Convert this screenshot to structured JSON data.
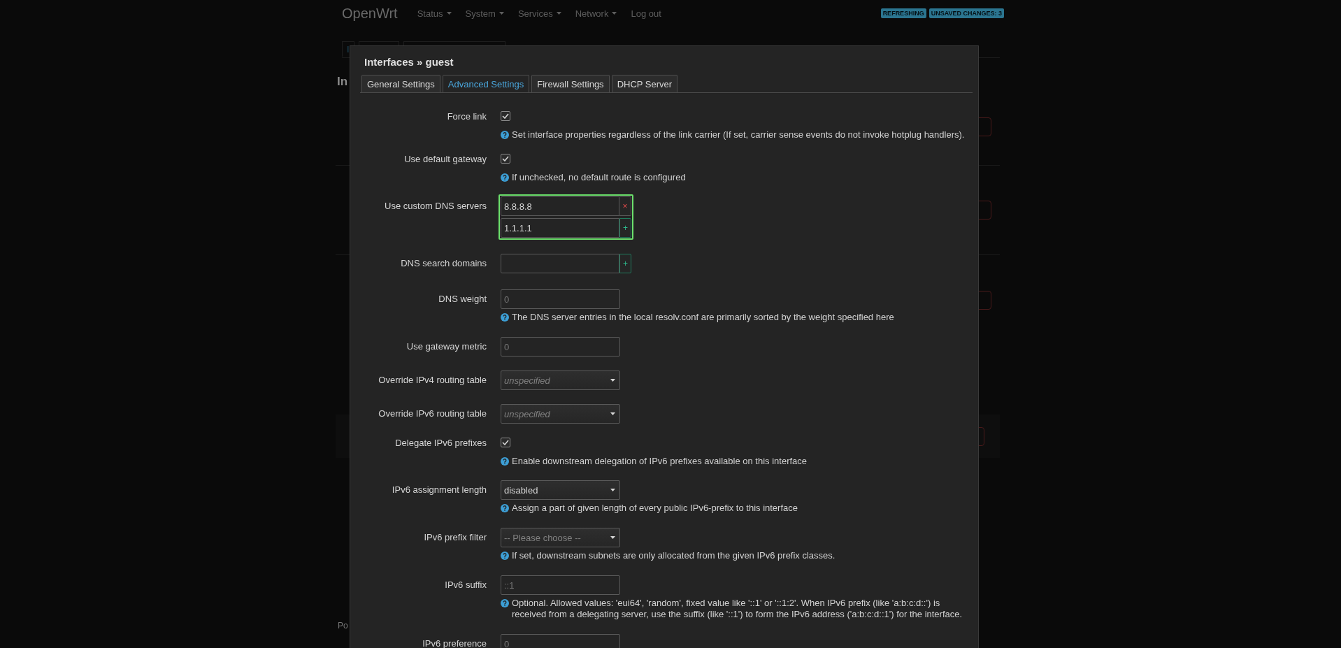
{
  "header": {
    "brand": "OpenWrt",
    "menu": [
      {
        "label": "Status",
        "dropdown": true
      },
      {
        "label": "System",
        "dropdown": true
      },
      {
        "label": "Services",
        "dropdown": true
      },
      {
        "label": "Network",
        "dropdown": true
      },
      {
        "label": "Log out",
        "dropdown": false
      }
    ],
    "badges": [
      "REFRESHING",
      "UNSAVED CHANGES: 3"
    ]
  },
  "background": {
    "tab_fragment": "I",
    "heading_fragment": "In",
    "footer_fragment": "Po"
  },
  "dialog": {
    "title": "Interfaces » guest",
    "tabs": [
      {
        "label": "General Settings",
        "selected": false
      },
      {
        "label": "Advanced Settings",
        "selected": true
      },
      {
        "label": "Firewall Settings",
        "selected": false
      },
      {
        "label": "DHCP Server",
        "selected": false
      }
    ],
    "rows": [
      {
        "kind": "checkbox",
        "label": "Force link",
        "checked": true,
        "help": "Set interface properties regardless of the link carrier (If set, carrier sense events do not invoke hotplug handlers)."
      },
      {
        "kind": "checkbox",
        "label": "Use default gateway",
        "checked": true,
        "help": "If unchecked, no default route is configured"
      },
      {
        "kind": "list",
        "label": "Use custom DNS servers",
        "focused": true,
        "entries": [
          {
            "value": "8.8.8.8",
            "kind": "remove",
            "symbol": "×"
          },
          {
            "value": "1.1.1.1",
            "kind": "add",
            "symbol": "+"
          }
        ]
      },
      {
        "kind": "list",
        "label": "DNS search domains",
        "focused": false,
        "entries": [
          {
            "kind": "add",
            "symbol": "+"
          }
        ]
      },
      {
        "kind": "text",
        "label": "DNS weight",
        "placeholder": "0",
        "help": "The DNS server entries in the local resolv.conf are primarily sorted by the weight specified here"
      },
      {
        "kind": "text",
        "label": "Use gateway metric",
        "placeholder": "0"
      },
      {
        "kind": "select",
        "label": "Override IPv4 routing table",
        "placeholder": "unspecified",
        "italic": true
      },
      {
        "kind": "select",
        "label": "Override IPv6 routing table",
        "placeholder": "unspecified",
        "italic": true
      },
      {
        "kind": "checkbox",
        "label": "Delegate IPv6 prefixes",
        "checked": true,
        "help": "Enable downstream delegation of IPv6 prefixes available on this interface"
      },
      {
        "kind": "select",
        "label": "IPv6 assignment length",
        "value": "disabled",
        "italic": false,
        "help": "Assign a part of given length of every public IPv6-prefix to this interface"
      },
      {
        "kind": "select",
        "label": "IPv6 prefix filter",
        "placeholder": "-- Please choose --",
        "italic": false,
        "help": "If set, downstream subnets are only allocated from the given IPv6 prefix classes."
      },
      {
        "kind": "text",
        "label": "IPv6 suffix",
        "placeholder": "::1",
        "help": "Optional. Allowed values: 'eui64', 'random', fixed value like '::1' or '::1:2'. When IPv6 prefix (like 'a:b:c:d::') is received from a delegating server, use the suffix (like '::1') to form the IPv6 address ('a:b:c:d::1') for the interface."
      },
      {
        "kind": "text",
        "label": "IPv6 preference",
        "placeholder": "0"
      }
    ]
  }
}
